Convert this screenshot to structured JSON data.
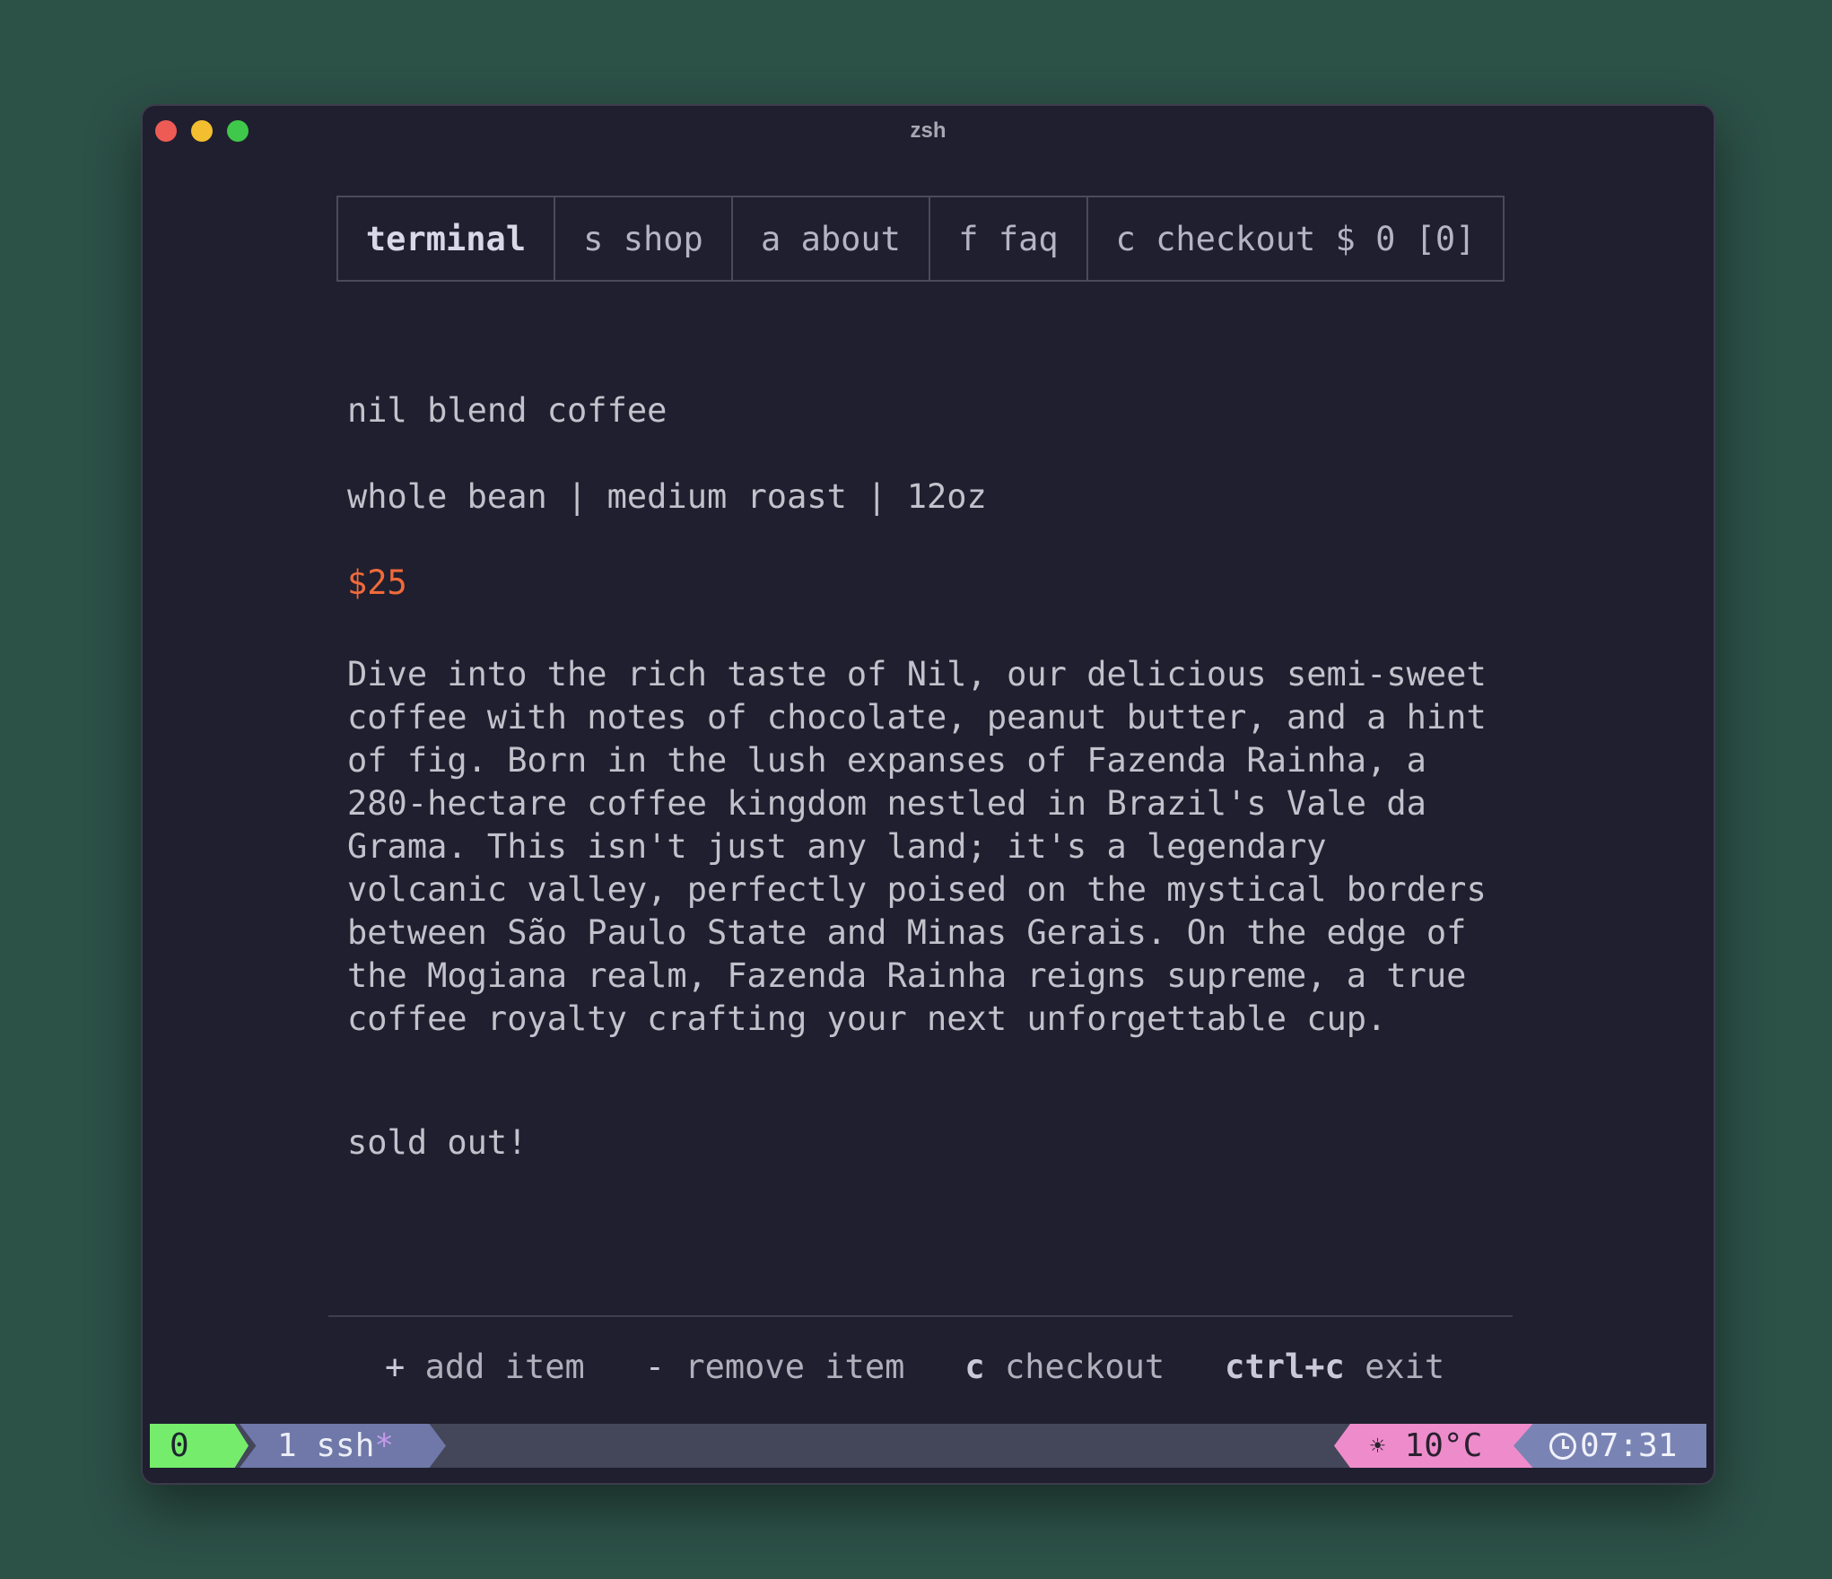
{
  "window": {
    "title": "zsh"
  },
  "tabs": [
    {
      "label": "terminal",
      "active": true
    },
    {
      "label": "s shop"
    },
    {
      "label": "a about"
    },
    {
      "label": "f faq"
    },
    {
      "label": "c checkout $ 0 [0]"
    }
  ],
  "product": {
    "name": "nil blend coffee",
    "details": "whole bean | medium roast | 12oz",
    "price": "$25",
    "description": "Dive into the rich taste of Nil, our delicious semi-sweet\ncoffee with notes of chocolate, peanut butter, and a hint\nof fig. Born in the lush expanses of Fazenda Rainha, a\n280-hectare coffee kingdom nestled in Brazil's Vale da\nGrama. This isn't just any land; it's a legendary\nvolcanic valley, perfectly poised on the mystical borders\nbetween São Paulo State and Minas Gerais. On the edge of\nthe Mogiana realm, Fazenda Rainha reigns supreme, a true\ncoffee royalty crafting your next unforgettable cup.",
    "status": "sold out!"
  },
  "help": [
    {
      "key": "+",
      "action": "add item"
    },
    {
      "key": "-",
      "action": "remove item"
    },
    {
      "key": "c",
      "action": "checkout"
    },
    {
      "key": "ctrl+c",
      "action": "exit"
    }
  ],
  "statusbar": {
    "session": "0",
    "window_index": "1",
    "window_name": "ssh",
    "window_flag": "*",
    "weather_icon": "☀",
    "temperature": "10°C",
    "time": "07:31"
  },
  "colors": {
    "background": "#2c5147",
    "terminal": "#1f1f2f",
    "price": "#f06a3a",
    "session_segment": "#76ec6c",
    "window_segment": "#6f78a8",
    "weather_segment": "#ee8ccb",
    "time_segment": "#7a84b4"
  }
}
